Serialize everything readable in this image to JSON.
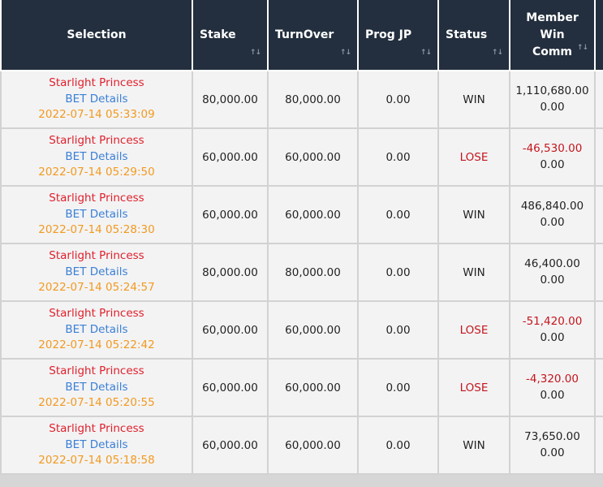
{
  "headers": {
    "selection": "Selection",
    "stake": "Stake",
    "turnover": "TurnOver",
    "prog_jp": "Prog JP",
    "status": "Status",
    "member_win_comm": [
      "Member",
      "Win",
      "Comm"
    ],
    "sort_icon": "sort-arrows-icon"
  },
  "rows": [
    {
      "game": "Starlight Princess",
      "bet_link": "BET Details",
      "datetime": "2022-07-14 05:33:09",
      "stake": "80,000.00",
      "turnover": "80,000.00",
      "prog_jp": "0.00",
      "status": "WIN",
      "win": "1,110,680.00",
      "comm": "0.00"
    },
    {
      "game": "Starlight Princess",
      "bet_link": "BET Details",
      "datetime": "2022-07-14 05:29:50",
      "stake": "60,000.00",
      "turnover": "60,000.00",
      "prog_jp": "0.00",
      "status": "LOSE",
      "win": "-46,530.00",
      "comm": "0.00"
    },
    {
      "game": "Starlight Princess",
      "bet_link": "BET Details",
      "datetime": "2022-07-14 05:28:30",
      "stake": "60,000.00",
      "turnover": "60,000.00",
      "prog_jp": "0.00",
      "status": "WIN",
      "win": "486,840.00",
      "comm": "0.00"
    },
    {
      "game": "Starlight Princess",
      "bet_link": "BET Details",
      "datetime": "2022-07-14 05:24:57",
      "stake": "80,000.00",
      "turnover": "80,000.00",
      "prog_jp": "0.00",
      "status": "WIN",
      "win": "46,400.00",
      "comm": "0.00"
    },
    {
      "game": "Starlight Princess",
      "bet_link": "BET Details",
      "datetime": "2022-07-14 05:22:42",
      "stake": "60,000.00",
      "turnover": "60,000.00",
      "prog_jp": "0.00",
      "status": "LOSE",
      "win": "-51,420.00",
      "comm": "0.00"
    },
    {
      "game": "Starlight Princess",
      "bet_link": "BET Details",
      "datetime": "2022-07-14 05:20:55",
      "stake": "60,000.00",
      "turnover": "60,000.00",
      "prog_jp": "0.00",
      "status": "LOSE",
      "win": "-4,320.00",
      "comm": "0.00"
    },
    {
      "game": "Starlight Princess",
      "bet_link": "BET Details",
      "datetime": "2022-07-14 05:18:58",
      "stake": "60,000.00",
      "turnover": "60,000.00",
      "prog_jp": "0.00",
      "status": "WIN",
      "win": "73,650.00",
      "comm": "0.00"
    }
  ],
  "colors": {
    "header_bg": "#232f3e",
    "game_name": "#e0202b",
    "bet_link": "#3a7fd5",
    "datetime": "#f29a1e",
    "lose": "#c4161c"
  }
}
